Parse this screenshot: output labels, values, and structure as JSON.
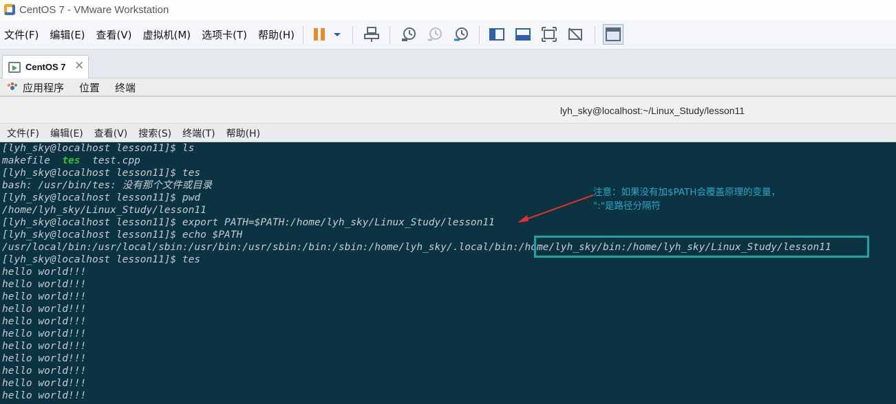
{
  "window": {
    "title": "CentOS 7 - VMware Workstation"
  },
  "vmware_menu": [
    "文件(F)",
    "编辑(E)",
    "查看(V)",
    "虚拟机(M)",
    "选项卡(T)",
    "帮助(H)"
  ],
  "vmware_toolbar_icons": [
    "pause-icon",
    "dropdown-icon",
    "send-ctrl-alt-del-icon",
    "snapshot-icon",
    "revert-snapshot-icon",
    "snapshot-manager-icon",
    "sidebar-icon",
    "console-view-icon",
    "fullscreen-icon",
    "unity-icon",
    "thumbnail-icon"
  ],
  "tab": {
    "label": "CentOS 7",
    "close": "✕"
  },
  "gnome_bar": {
    "items": [
      "应用程序",
      "位置",
      "终端"
    ]
  },
  "terminal": {
    "title": "lyh_sky@localhost:~/Linux_Study/lesson11",
    "menu": [
      "文件(F)",
      "编辑(E)",
      "查看(V)",
      "搜索(S)",
      "终端(T)",
      "帮助(H)"
    ],
    "lines": [
      "[lyh_sky@localhost lesson11]$ ls",
      "makefile  ",
      "[lyh_sky@localhost lesson11]$ tes",
      "bash: /usr/bin/tes: 没有那个文件或目录",
      "[lyh_sky@localhost lesson11]$ pwd",
      "/home/lyh_sky/Linux_Study/lesson11",
      "[lyh_sky@localhost lesson11]$ export PATH=$PATH:/home/lyh_sky/Linux_Study/lesson11",
      "[lyh_sky@localhost lesson11]$ echo $PATH",
      "/usr/local/bin:/usr/local/sbin:/usr/bin:/usr/sbin:/bin:/sbin:/home/lyh_sky/.local/bin:/home/lyh_sky/bin:/home/lyh_sky/Linux_Study/lesson11",
      "[lyh_sky@localhost lesson11]$ tes",
      "hello world!!!",
      "hello world!!!",
      "hello world!!!",
      "hello world!!!",
      "hello world!!!",
      "hello world!!!",
      "hello world!!!",
      "hello world!!!",
      "hello world!!!",
      "hello world!!!",
      "hello world!!!"
    ],
    "ls_executable": "tes",
    "ls_rest": "  test.cpp"
  },
  "annotation": {
    "line1": "注意：如果没有加$PATH会覆盖原理的变量，",
    "line2": "\":\"是路径分隔符",
    "color": "#2aa6c7",
    "arrow_color": "#e0302a",
    "box_color": "#1da5a5"
  },
  "colors": {
    "terminal_bg": "#0b3342",
    "terminal_fg": "#c6ccd0",
    "executable": "#35c235"
  }
}
